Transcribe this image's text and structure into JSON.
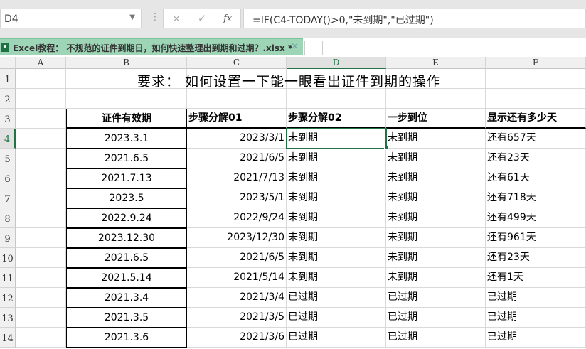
{
  "name_box": "D4",
  "formula_bar": {
    "cancel_icon": "×",
    "enter_icon": "✓",
    "fx_label": "fx",
    "formula": "=IF(C4-TODAY()>0,\"未到期\",\"已过期\")"
  },
  "workbook_tab": {
    "title": "Excel教程： 不规范的证件到期日，如何快速整理出到期和过期？.xlsx *",
    "close": "×"
  },
  "columns": [
    "A",
    "B",
    "C",
    "D",
    "E",
    "F"
  ],
  "rows": [
    "1",
    "2",
    "3",
    "4",
    "5",
    "6",
    "7",
    "8",
    "9",
    "10",
    "11",
    "12",
    "13",
    "14"
  ],
  "title": "要求：  如何设置一下能一眼看出证件到期的操作",
  "headers": [
    "证件有效期",
    "步骤分解01",
    "步骤分解02",
    "一步到位",
    "显示还有多少天"
  ],
  "data": [
    [
      "2023.3.1",
      "2023/3/1",
      "未到期",
      "未到期",
      "还有657天"
    ],
    [
      "2021.6.5",
      "2021/6/5",
      "未到期",
      "未到期",
      "还有23天"
    ],
    [
      "2021.7.13",
      "2021/7/13",
      "未到期",
      "未到期",
      "还有61天"
    ],
    [
      "2023.5",
      "2023/5/1",
      "未到期",
      "未到期",
      "还有718天"
    ],
    [
      "2022.9.24",
      "2022/9/24",
      "未到期",
      "未到期",
      "还有499天"
    ],
    [
      "2023.12.30",
      "2023/12/30",
      "未到期",
      "未到期",
      "还有961天"
    ],
    [
      "2021.6.5",
      "2021/6/5",
      "未到期",
      "未到期",
      "还有23天"
    ],
    [
      "2021.5.14",
      "2021/5/14",
      "未到期",
      "未到期",
      "还有1天"
    ],
    [
      "2021.3.4",
      "2021/3/4",
      "已过期",
      "已过期",
      "已过期"
    ],
    [
      "2021.3.5",
      "2021/3/5",
      "已过期",
      "已过期",
      "已过期"
    ],
    [
      "2021.3.6",
      "2021/3/6",
      "已过期",
      "已过期",
      "已过期"
    ]
  ]
}
